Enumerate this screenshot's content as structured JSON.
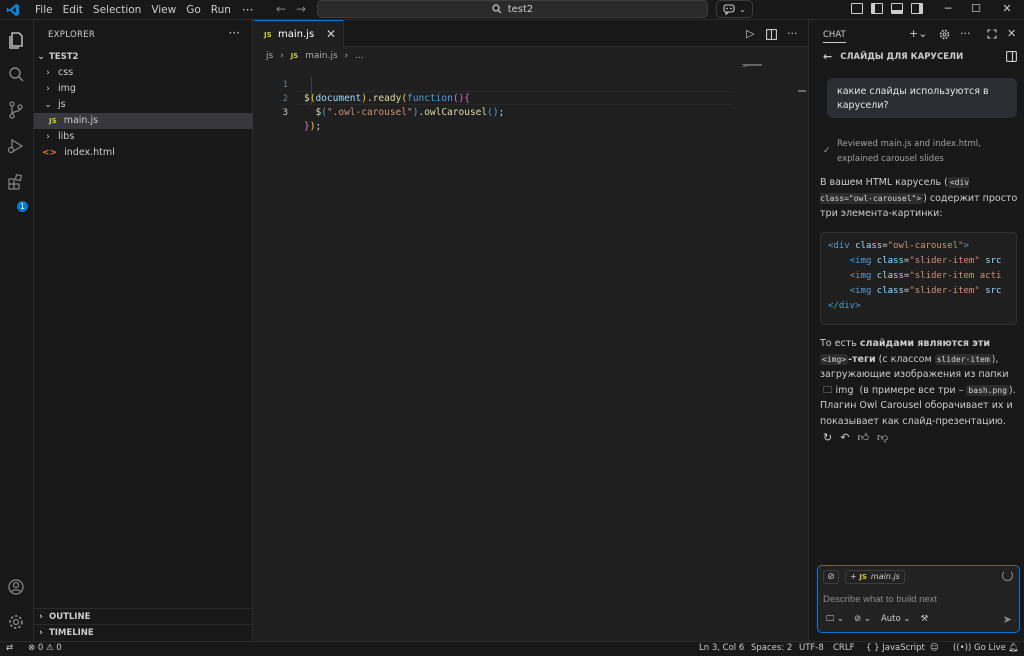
{
  "titlebar": {
    "menu": [
      "File",
      "Edit",
      "Selection",
      "View",
      "Go",
      "Run"
    ],
    "more": "···",
    "search_text": "test2"
  },
  "explorer": {
    "title": "EXPLORER",
    "more": "···",
    "project": "TEST2",
    "items": [
      {
        "label": "css",
        "type": "folder",
        "expanded": false
      },
      {
        "label": "img",
        "type": "folder",
        "expanded": false
      },
      {
        "label": "js",
        "type": "folder",
        "expanded": true
      },
      {
        "label": "main.js",
        "type": "js-file",
        "selected": true
      },
      {
        "label": "libs",
        "type": "folder",
        "expanded": false
      },
      {
        "label": "index.html",
        "type": "html-file"
      }
    ],
    "outline": "OUTLINE",
    "timeline": "TIMELINE",
    "badge_count": "1"
  },
  "editor": {
    "tab_label": "main.js",
    "breadcrumb": [
      "js",
      "main.js",
      "..."
    ],
    "line_numbers": [
      "1",
      "2",
      "3"
    ]
  },
  "chat": {
    "title": "CHAT",
    "heading": "СЛАЙДЫ ДЛЯ КАРУСЕЛИ",
    "user_message": "какие слайды используются в карусели?",
    "reviewed": "Reviewed main.js and index.html, explained carousel slides",
    "answer_p1_a": "В вашем HTML карусель (",
    "answer_p1_code": "<div class=\"owl-carousel\">",
    "answer_p1_b": ") содержит просто три элемента-картинки:",
    "codeblock": [
      "<div class=\"owl-carousel\">",
      "    <img class=\"slider-item\" src",
      "    <img class=\"slider-item acti",
      "    <img class=\"slider-item\" src",
      "</div>"
    ],
    "answer_p2_a": "То есть ",
    "answer_p2_bold": "слайдами являются эти",
    "answer_p2_code1": "<img>",
    "answer_p2_bold2": "-теги",
    "answer_p2_b": " (с классом ",
    "answer_p2_code2": "slider-item",
    "answer_p2_c": "), загружающие изображения из папки ",
    "answer_p2_folder": "img",
    "answer_p2_d": " (в примере все три – ",
    "answer_p2_code3": "bash.png",
    "answer_p2_e": "). Плагин Owl Carousel оборачивает их и показывает как слайд-презентацию.",
    "input_chip": "main.js",
    "input_placeholder": "Describe what to build next",
    "mode_label": "Auto"
  },
  "statusbar": {
    "errors": "0",
    "warnings": "0",
    "position": "Ln 3, Col 6",
    "spaces": "Spaces: 2",
    "encoding": "UTF-8",
    "eol": "CRLF",
    "language": "JavaScript",
    "golive": "Go Live"
  },
  "colors": {
    "accent": "#0078d4",
    "background": "#1f1f1f",
    "sidebar": "#181818",
    "js_icon": "#cbcb41",
    "html_icon": "#e37933"
  },
  "icons": [
    "vscode-logo",
    "files-icon",
    "search-icon",
    "source-control-icon",
    "run-debug-icon",
    "extensions-icon",
    "account-icon",
    "settings-gear-icon",
    "copilot-icon",
    "layout-icons",
    "run-icon",
    "split-editor-icon",
    "new-chat-icon",
    "gear-icon",
    "maximize-icon",
    "close-icon",
    "back-arrow-icon",
    "sidebar-toggle-icon",
    "check-icon",
    "retry-icon",
    "undo-icon",
    "thumbs-up-icon",
    "thumbs-down-icon",
    "attach-icon",
    "send-icon",
    "bell-icon"
  ]
}
